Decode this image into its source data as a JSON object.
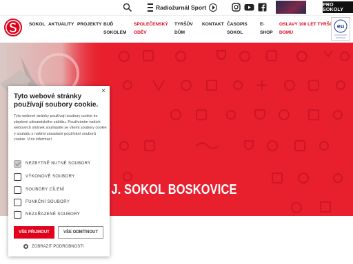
{
  "topbar": {
    "radio_label": "Radiožurnál Sport",
    "pro_sokoly": "PRO SOKOLY"
  },
  "nav": {
    "items": [
      {
        "label": "SOKOL"
      },
      {
        "label": "AKTUALITY"
      },
      {
        "label": "PROJEKTY"
      },
      {
        "label": "BUĎ\nSOKOLEM"
      },
      {
        "label": "SPOLEČENSKÝ\nODĚV"
      },
      {
        "label": "TYRŠŮV\nDŮM"
      },
      {
        "label": "KONTAKT"
      },
      {
        "label": "ČASOPIS\nSOKOL"
      },
      {
        "label": "E-\nSHOP"
      },
      {
        "label": "OSLAVY 100 LET TYRŠOVA\nDOMU"
      }
    ],
    "eu_badge": "eu"
  },
  "hero": {
    "title": ". J. SOKOL BOSKOVICE"
  },
  "cookie": {
    "close": "×",
    "title": "Tyto webové stránky používají soubory cookie.",
    "text": "Tyto webové stránky používají soubory cookie ke zlepšení uživatelského zážitku. Používáním našich webových stránek souhlasíte se všemi soubory cookie v souladu s našimi zásadami používání souborů cookie. Více informací",
    "options": [
      {
        "label": "NEZBYTNĚ NUTNÉ SOUBORY",
        "checked": true
      },
      {
        "label": "VÝKONOVÉ SOUBORY",
        "checked": false
      },
      {
        "label": "SOUBORY CÍLENÍ",
        "checked": false
      },
      {
        "label": "FUNKČNÍ SOUBORY",
        "checked": false
      },
      {
        "label": "NEZAŘAZENÉ SOUBORY",
        "checked": false
      }
    ],
    "accept": "VŠE PŘIJMOUT",
    "reject": "VŠE ODMÍTNOUT",
    "details": "ZOBRAZIT PODROBNOSTI"
  },
  "colors": {
    "brand_red": "#e2001a",
    "hero_red": "#e8202e"
  }
}
